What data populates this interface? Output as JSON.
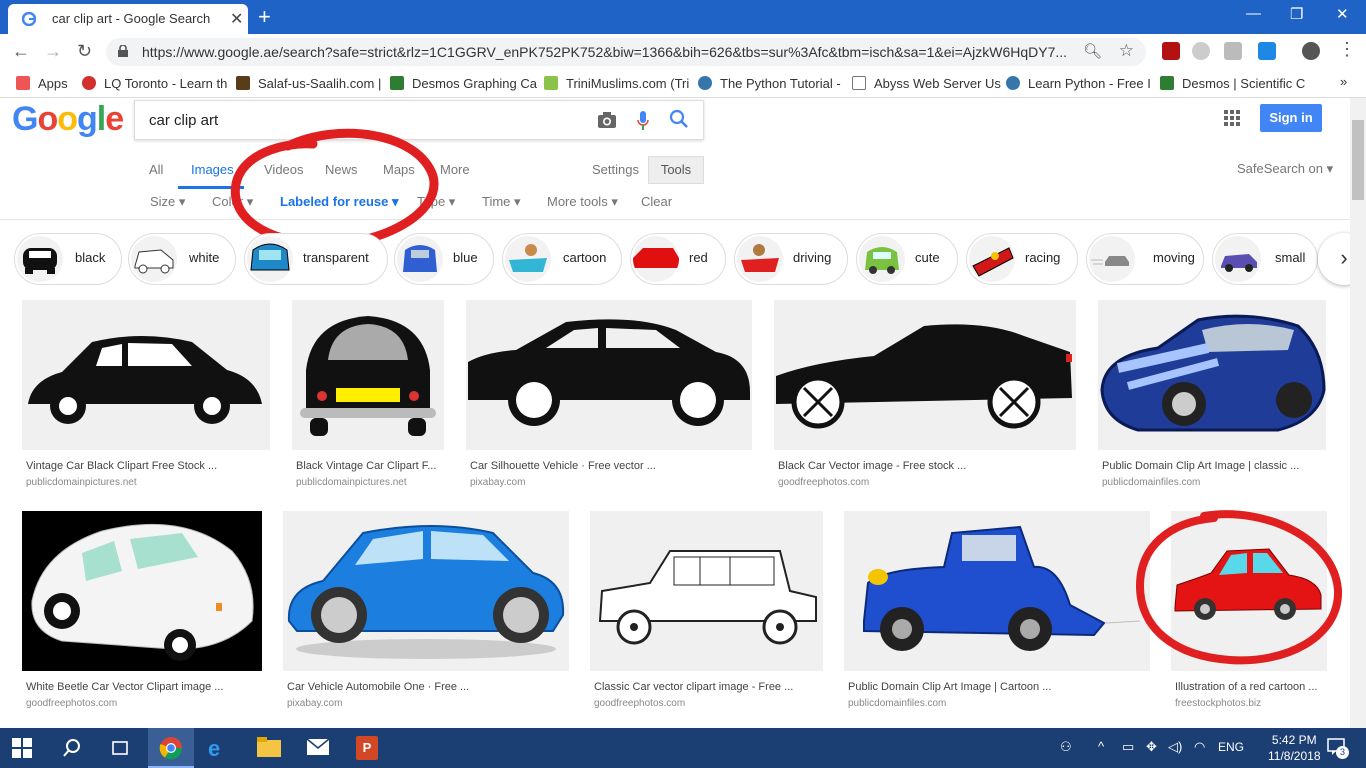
{
  "browser": {
    "tab_title": "car clip art - Google Search",
    "url": "https://www.google.ae/search?safe=strict&rlz=1C1GGRV_enPK752PK752&biw=1366&bih=626&tbs=sur%3Afc&tbm=isch&sa=1&ei=AjzkW6HqDY7...",
    "bookmarks": [
      "Apps",
      "LQ Toronto - Learn th",
      "Salaf-us-Saalih.com |",
      "Desmos Graphing Ca",
      "TriniMuslims.com (Tri",
      "The Python Tutorial -",
      "Abyss Web Server Us",
      "Learn Python - Free I",
      "Desmos | Scientific C"
    ]
  },
  "search": {
    "logo": "Google",
    "query": "car clip art",
    "signin": "Sign in",
    "tabs": [
      "All",
      "Images",
      "Videos",
      "News",
      "Maps",
      "More"
    ],
    "settings": "Settings",
    "tools": "Tools",
    "safesearch": "SafeSearch on",
    "toolbar": [
      "Size",
      "Color",
      "Labeled for reuse",
      "Type",
      "Time",
      "More tools",
      "Clear"
    ]
  },
  "chips": [
    "black",
    "white",
    "transparent",
    "blue",
    "cartoon",
    "red",
    "driving",
    "cute",
    "racing",
    "moving",
    "small"
  ],
  "results": [
    {
      "caption": "Vintage Car Black Clipart Free Stock ...",
      "source": "publicdomainpictures.net"
    },
    {
      "caption": "Black Vintage Car Clipart F...",
      "source": "publicdomainpictures.net"
    },
    {
      "caption": "Car Silhouette Vehicle · Free vector ...",
      "source": "pixabay.com"
    },
    {
      "caption": "Black Car Vector image - Free stock ...",
      "source": "goodfreephotos.com"
    },
    {
      "caption": "Public Domain Clip Art Image | classic ...",
      "source": "publicdomainfiles.com"
    },
    {
      "caption": "White Beetle Car Vector Clipart image ...",
      "source": "goodfreephotos.com"
    },
    {
      "caption": "Car Vehicle Automobile One · Free ...",
      "source": "pixabay.com"
    },
    {
      "caption": "Classic Car vector clipart image - Free ...",
      "source": "goodfreephotos.com"
    },
    {
      "caption": "Public Domain Clip Art Image | Cartoon ...",
      "source": "publicdomainfiles.com"
    },
    {
      "caption": "Illustration of a red cartoon ...",
      "source": "freestockphotos.biz"
    }
  ],
  "taskbar": {
    "lang": "ENG",
    "time": "5:42 PM",
    "date": "11/8/2018",
    "notifications": "3"
  },
  "colors": {
    "titlebar": "#1f63c6",
    "accent_blue": "#1a73e8",
    "annotation_red": "#e02020",
    "taskbar": "#1c3f73"
  }
}
